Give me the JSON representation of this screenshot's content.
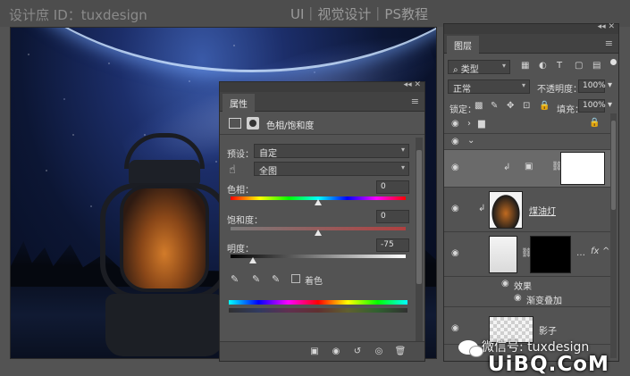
{
  "watermark": {
    "left": "设计庶 ID：tuxdesign",
    "center": "UI｜视觉设计｜PS教程",
    "wechat": "微信号: tuxdesign",
    "site": "UiBQ.CoM"
  },
  "properties": {
    "tab": "属性",
    "adjustment_title": "色相/饱和度",
    "preset_label": "预设：",
    "preset_value": "自定",
    "channel_value": "全图",
    "hue_label": "色相：",
    "hue_value": "0",
    "saturation_label": "饱和度：",
    "saturation_value": "0",
    "lightness_label": "明度：",
    "lightness_value": "-75",
    "hue_position": 0.5,
    "saturation_position": 0.5,
    "lightness_position": 0.125,
    "colorize_label": "着色"
  },
  "layers": {
    "tab": "图层",
    "filter_kind": "类型",
    "blend_mode": "正常",
    "opacity_label": "不透明度：",
    "opacity_value": "100%",
    "lock_label": "锁定：",
    "fill_label": "填充：",
    "fill_value": "100%",
    "items": [
      {
        "name": "煤油灯"
      },
      {
        "name": "效果"
      },
      {
        "name": "渐变叠加"
      },
      {
        "name": "影子"
      }
    ]
  },
  "colors": {
    "panel_bg": "#535353",
    "panel_dark": "#424242",
    "accent_white": "#ffffff"
  }
}
